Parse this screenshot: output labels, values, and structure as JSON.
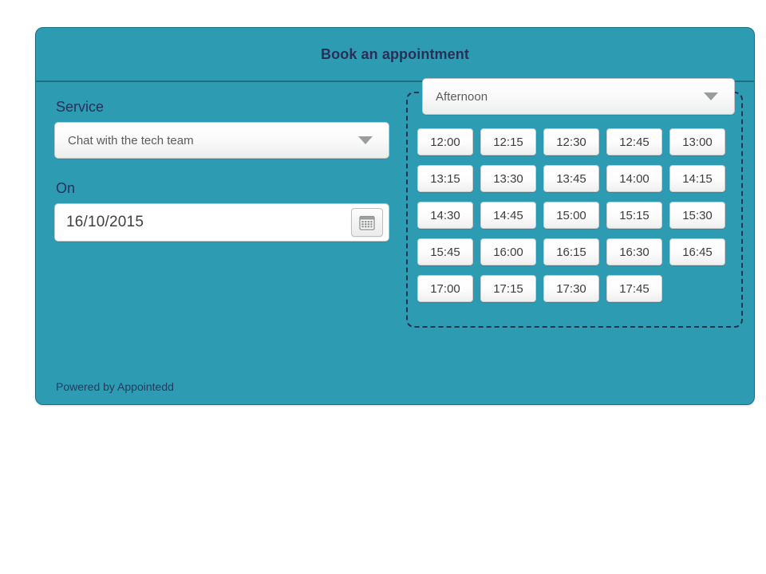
{
  "page": {
    "background": "#ffffff"
  },
  "widget": {
    "title": "Book an appointment",
    "accent_color": "#2d9cb3",
    "title_color": "#28305a",
    "footer_text": "Powered by Appointedd"
  },
  "form": {
    "service": {
      "label": "Service",
      "selected": "Chat with the tech team",
      "caret_icon": "chevron-down-icon"
    },
    "date": {
      "label": "On",
      "value": "16/10/2015",
      "calendar_icon": "calendar-icon"
    }
  },
  "slots": {
    "period": {
      "selected": "Afternoon",
      "caret_icon": "chevron-down-icon"
    },
    "times": [
      "12:00",
      "12:15",
      "12:30",
      "12:45",
      "13:00",
      "13:15",
      "13:30",
      "13:45",
      "14:00",
      "14:15",
      "14:30",
      "14:45",
      "15:00",
      "15:15",
      "15:30",
      "15:45",
      "16:00",
      "16:15",
      "16:30",
      "16:45",
      "17:00",
      "17:15",
      "17:30",
      "17:45"
    ]
  }
}
